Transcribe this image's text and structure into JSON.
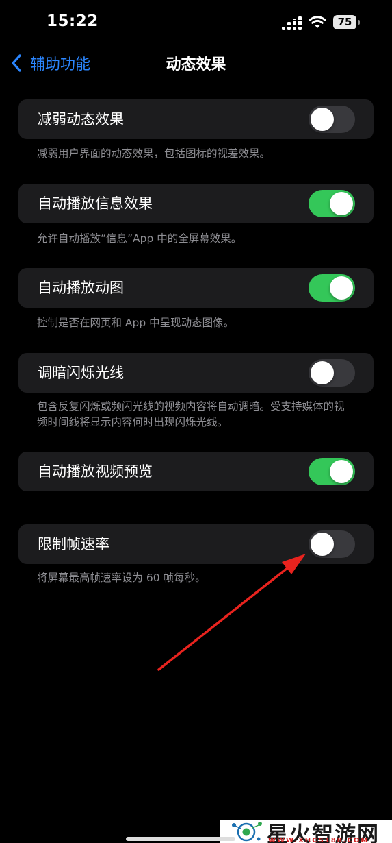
{
  "status_bar": {
    "time": "15:22",
    "battery": "75"
  },
  "nav": {
    "back_label": "辅助功能",
    "title": "动态效果"
  },
  "settings": [
    {
      "label": "减弱动态效果",
      "on": false,
      "description": "减弱用户界面的动态效果，包括图标的视差效果。"
    },
    {
      "label": "自动播放信息效果",
      "on": true,
      "description": "允许自动播放“信息”App 中的全屏幕效果。"
    },
    {
      "label": "自动播放动图",
      "on": true,
      "description": "控制是否在网页和 App 中呈现动态图像。"
    },
    {
      "label": "调暗闪烁光线",
      "on": false,
      "description": "包含反复闪烁或频闪光线的视频内容将自动调暗。受支持媒体的视频时间线将显示内容何时出现闪烁光线。"
    },
    {
      "label": "自动播放视频预览",
      "on": true,
      "description": ""
    },
    {
      "label": "限制帧速率",
      "on": false,
      "description": "将屏幕最高帧速率设为 60 帧每秒。"
    }
  ],
  "watermark": {
    "title": "星火智游网",
    "url": "WWW.XHCS188.COM"
  },
  "colors": {
    "accent": "#2b86ff",
    "toggle_on": "#34c759",
    "toggle_off": "#39393d",
    "cell_bg": "#1c1c1e",
    "secondary_text": "#8e8e93",
    "annotation_arrow": "#e8231e"
  },
  "icons": {
    "back": "chevron-left-icon",
    "signal": "cellular-signal-icon",
    "wifi": "wifi-icon",
    "battery": "battery-icon"
  }
}
